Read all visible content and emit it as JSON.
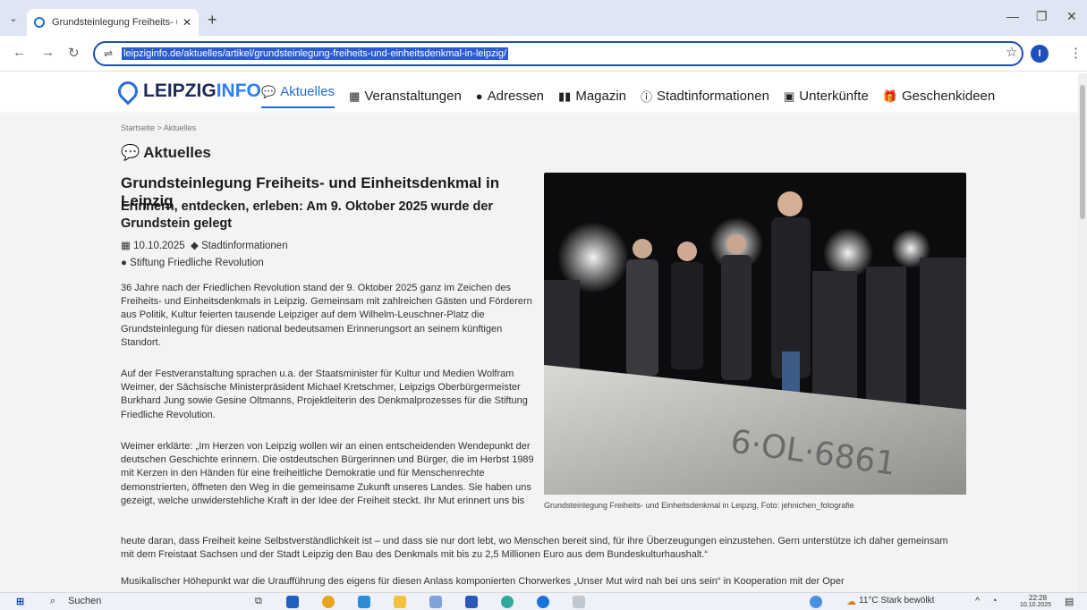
{
  "browser": {
    "tab_title": "Grundsteinlegung Freiheits- un",
    "url": "leipziginfo.de/aktuelles/artikel/grundsteinlegung-freiheits-und-einheitsdenkmal-in-leipzig/",
    "profile_initial": "I"
  },
  "site": {
    "logo_part1": "LEIPZIG",
    "logo_part2": "INFO",
    "menu": [
      {
        "label": "Aktuelles",
        "icon": "comments-icon"
      },
      {
        "label": "Veranstaltungen",
        "icon": "calendar-icon"
      },
      {
        "label": "Adressen",
        "icon": "map-marker-icon"
      },
      {
        "label": "Magazin",
        "icon": "book-icon"
      },
      {
        "label": "Stadtinformationen",
        "icon": "info-icon"
      },
      {
        "label": "Unterkünfte",
        "icon": "bed-icon"
      },
      {
        "label": "Geschenkideen",
        "icon": "gift-icon"
      }
    ]
  },
  "article": {
    "breadcrumb": "Startseite > Aktuelles",
    "section_title": "Aktuelles",
    "title": "Grundsteinlegung Freiheits- und Einheitsdenkmal in Leipzig",
    "subtitle": "Erinnern, entdecken, erleben: Am 9. Oktober 2025 wurde der Grundstein gelegt",
    "date": "10.10.2025",
    "category": "Stadtinformationen",
    "author": "Stiftung Friedliche Revolution",
    "p1": "36 Jahre nach der Friedlichen Revolution stand der 9. Oktober 2025 ganz im Zeichen des Freiheits- und Einheitsdenkmals in Leipzig. Gemeinsam mit zahlreichen Gästen und Förderern aus Politik, Kultur feierten tausende Leipziger auf dem Wilhelm-Leuschner-Platz die Grundsteinlegung für diesen national bedeutsamen Erinnerungsort an seinem künftigen Standort.",
    "p2": "Auf der Festveranstaltung sprachen u.a. der Staatsminister für Kultur und Medien Wolfram Weimer, der Sächsische Ministerpräsident Michael Kretschmer, Leipzigs Oberbürgermeister Burkhard Jung sowie Gesine Oltmanns, Projektleiterin des Denkmalprozesses für die Stiftung Friedliche Revolution.",
    "p3": "Weimer erklärte: „Im Herzen von Leipzig wollen wir an einen entscheidenden Wendepunkt der deutschen Geschichte erinnern. Die ostdeutschen Bürgerinnen und Bürger, die im Herbst 1989 mit Kerzen in den Händen für eine freiheitliche Demokratie und für Menschenrechte demonstrierten, öffneten den Weg in die gemeinsame Zukunft unseres Landes. Sie haben uns gezeigt, welche unwiderstehliche Kraft in der Idee der Freiheit steckt. Ihr Mut erinnert uns bis",
    "p3_cont": "heute daran, dass Freiheit keine Selbstverständlichkeit ist – und dass sie nur dort lebt, wo Menschen bereit sind, für ihre Überzeugungen einzustehen. Gern unterstütze ich daher gemeinsam mit dem Freistaat Sachsen und der Stadt Leipzig den Bau des Denkmals mit bis zu 2,5 Millionen Euro aus dem Bundeskulturhaushalt.“",
    "p4": "Musikalischer Höhepunkt war die Uraufführung des eigens für diesen Anlass komponierten Chorwerkes „Unser Mut wird nah bei uns sein“ in Kooperation mit der Oper",
    "photo_stone_text": "6·OL·6861",
    "caption": "Grundsteinlegung Freiheits- und Einheitsdenkmal in Leipzig, Foto: jehnichen_fotografie"
  },
  "taskbar": {
    "search": "Suchen",
    "weather": "11°C  Stark bewölkt",
    "time": "22:28",
    "date": "10.10.2025"
  }
}
